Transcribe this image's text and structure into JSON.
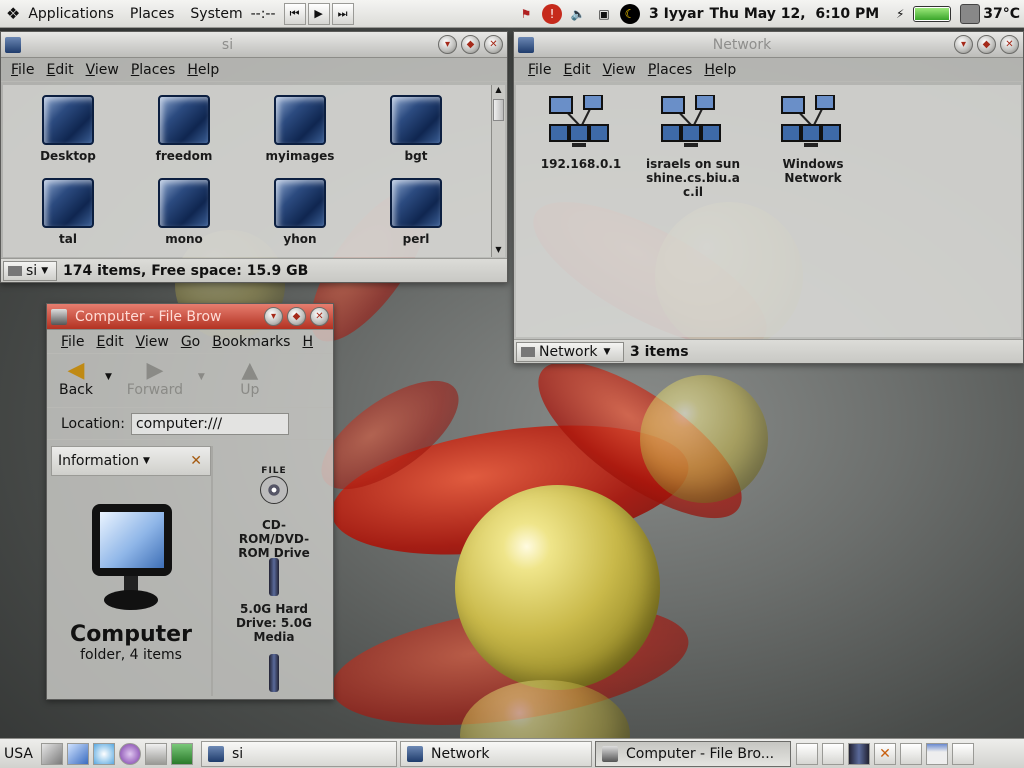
{
  "top_panel": {
    "menus": [
      "Applications",
      "Places",
      "System"
    ],
    "clock_text": "--:--",
    "date_hebrew": "3 Iyyar",
    "datetime": "Thu May 12,  6:10 PM",
    "temperature": "37°C",
    "battery_level": 1.0
  },
  "win_si": {
    "title": "si",
    "menu": [
      "File",
      "Edit",
      "View",
      "Places",
      "Help"
    ],
    "items": [
      "Desktop",
      "freedom",
      "myimages",
      "bgt",
      "tal",
      "mono",
      "yhon",
      "perl"
    ],
    "location_combo": "si",
    "status": "174 items, Free space: 15.9 GB"
  },
  "win_network": {
    "title": "Network",
    "menu": [
      "File",
      "Edit",
      "View",
      "Places",
      "Help"
    ],
    "items": [
      "192.168.0.1",
      "israels on sunshine.cs.biu.ac.il",
      "Windows Network"
    ],
    "location_combo": "Network",
    "status": "3 items"
  },
  "win_computer": {
    "title": "Computer - File Brow",
    "menu": [
      "File",
      "Edit",
      "View",
      "Go",
      "Bookmarks",
      "H"
    ],
    "toolbar": {
      "back": "Back",
      "forward": "Forward",
      "up": "Up"
    },
    "location_label": "Location:",
    "location_value": "computer:///",
    "side_pane_selector": "Information",
    "side_title": "Computer",
    "side_subtitle": "folder, 4 items",
    "drives": [
      {
        "label": "CD-ROM/DVD-ROM Drive",
        "icon_text": "FILE"
      },
      {
        "label": "5.0G Hard Drive: 5.0G Media"
      },
      {
        "label": ""
      }
    ]
  },
  "bottom_panel": {
    "keyboard": "USA",
    "tasks": [
      {
        "label": "si"
      },
      {
        "label": "Network"
      },
      {
        "label": "Computer - File Bro..."
      }
    ]
  },
  "colors": {
    "active_title": "#c23a2a",
    "folder_blue": "#1f3c6c",
    "wallpaper_red": "#b8200e",
    "wallpaper_yellow": "#d8c85a"
  }
}
